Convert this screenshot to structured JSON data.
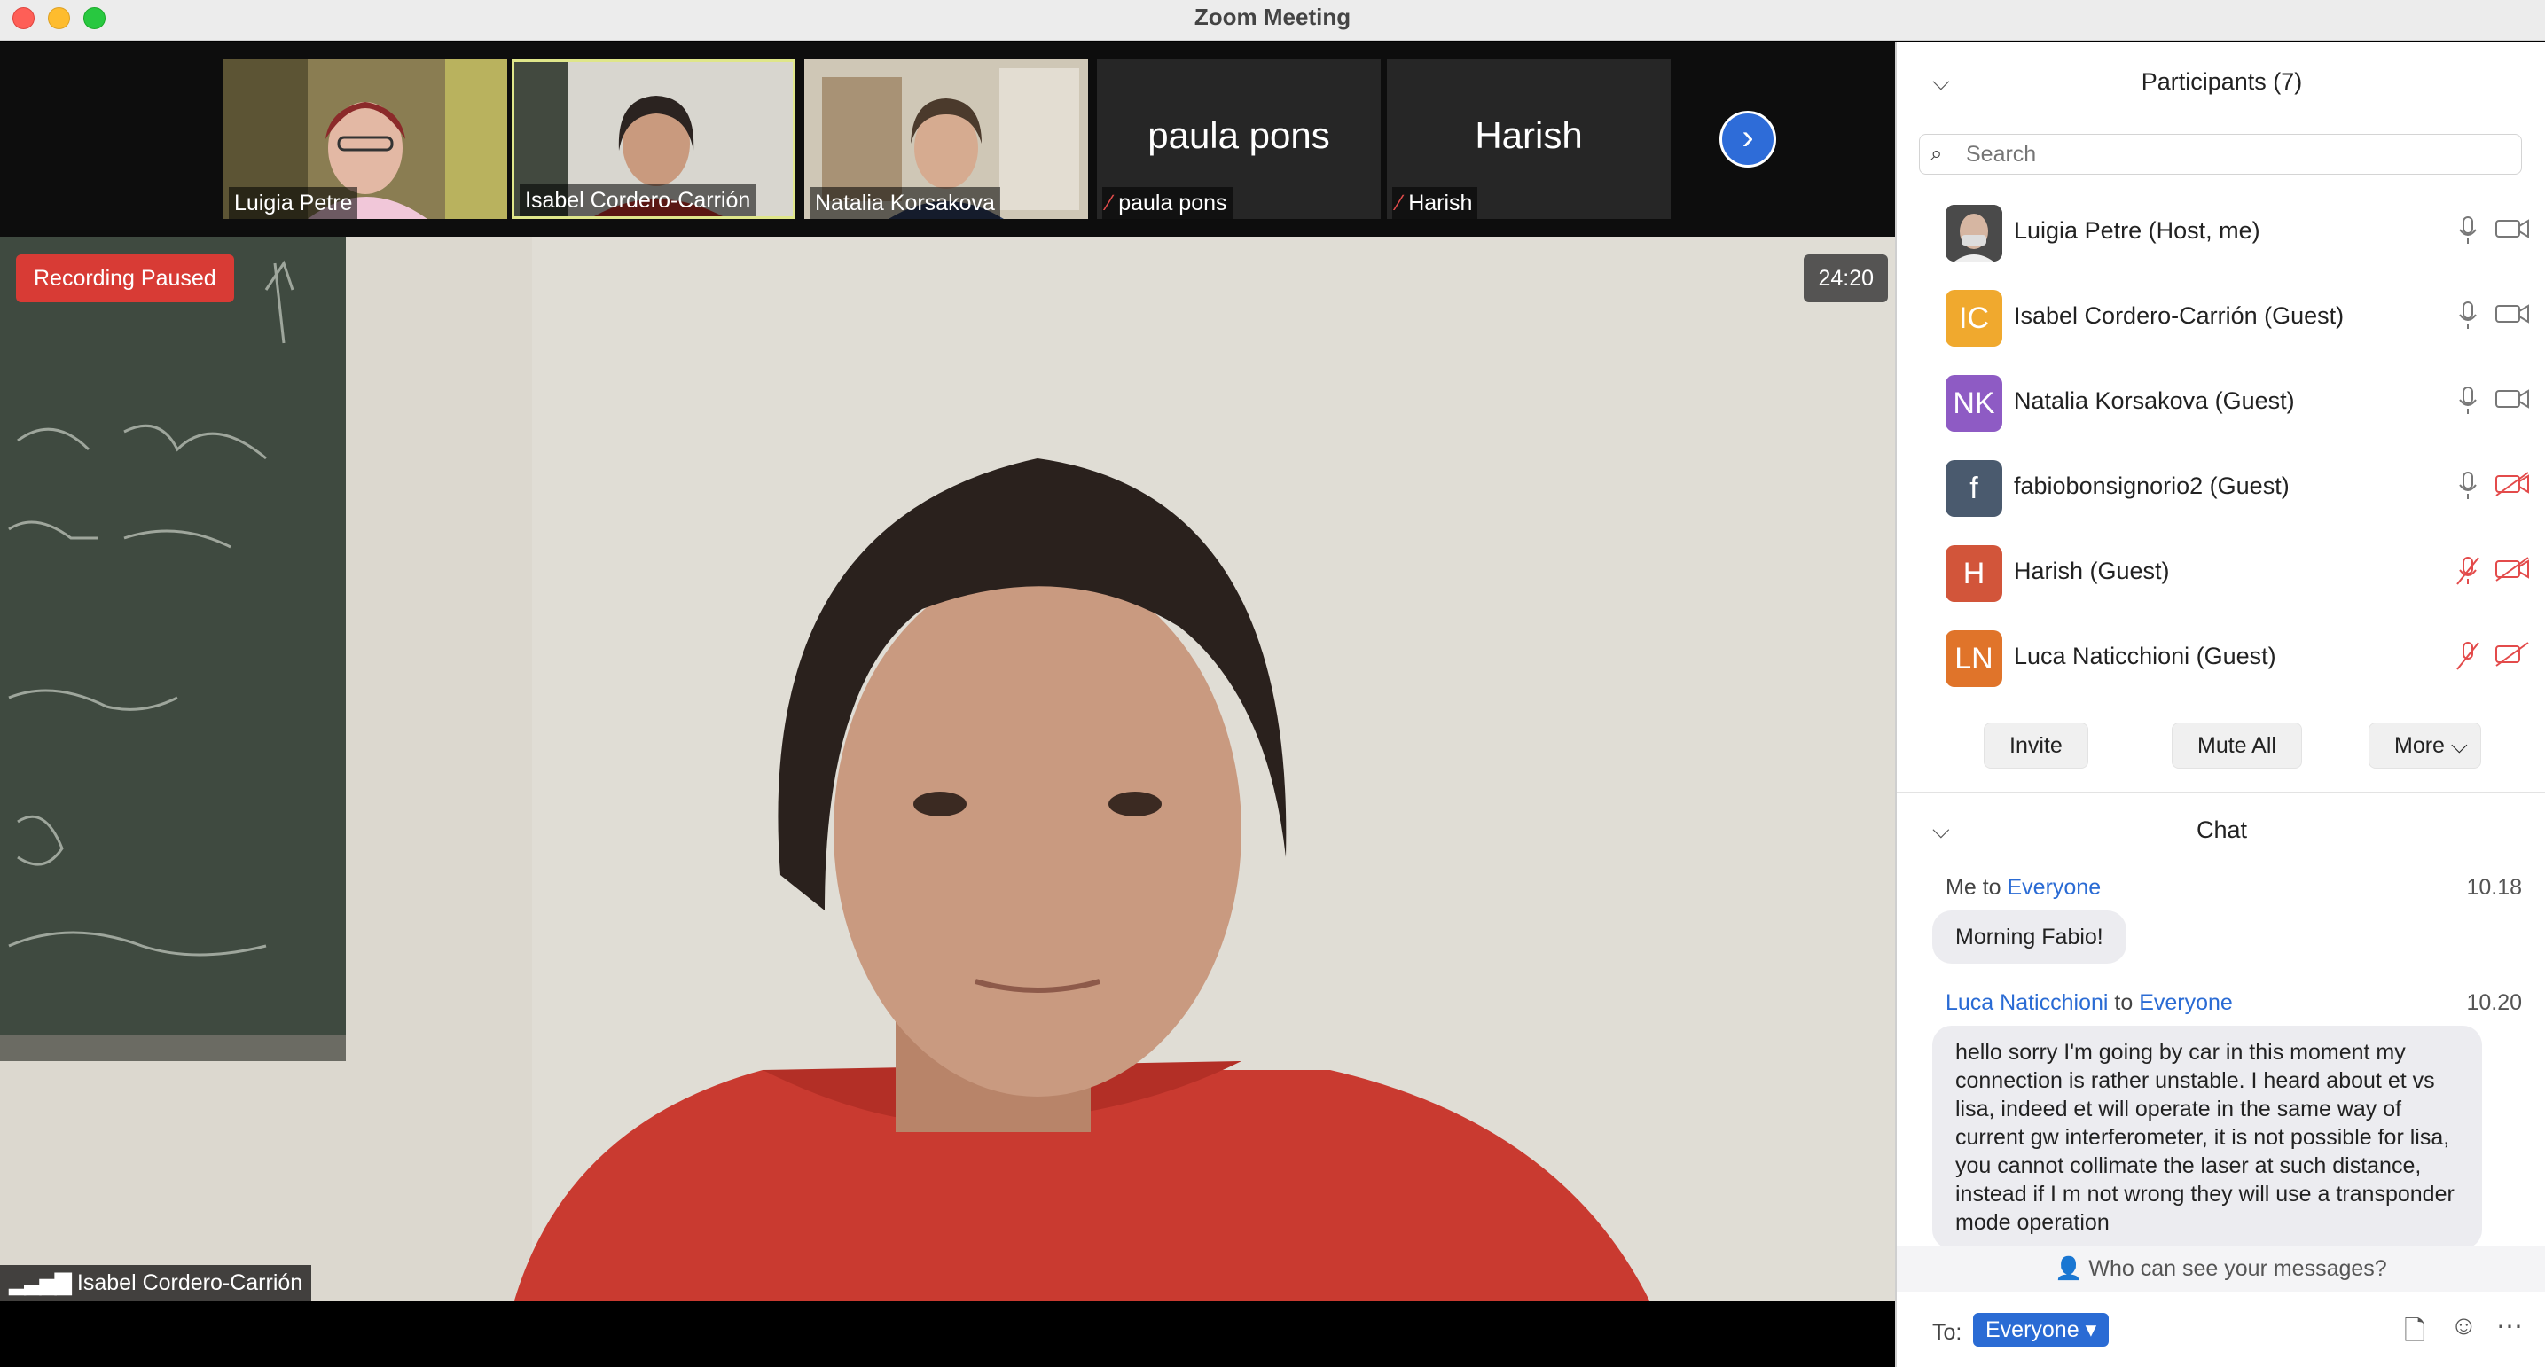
{
  "window": {
    "title": "Zoom Meeting"
  },
  "thumbnails": [
    {
      "name": "Luigia Petre",
      "has_video": true,
      "muted": false
    },
    {
      "name": "Isabel Cordero-Carrión",
      "has_video": true,
      "muted": false,
      "active_speaker": true
    },
    {
      "name": "Natalia Korsakova",
      "has_video": true,
      "muted": false
    },
    {
      "name": "paula pons",
      "big_label": "paula pons",
      "has_video": false,
      "muted": true
    },
    {
      "name": "Harish",
      "big_label": "Harish",
      "has_video": false,
      "muted": true
    }
  ],
  "main_video": {
    "recording_status": "Recording Paused",
    "timer": "24:20",
    "speaker_name": "Isabel Cordero-Carrión"
  },
  "participants": {
    "title": "Participants (7)",
    "search_placeholder": "Search",
    "list": [
      {
        "name": "Luigia Petre (Host, me)",
        "initials": "",
        "color": "#3a3a3a",
        "mic_on": true,
        "cam_on": true
      },
      {
        "name": "Isabel Cordero-Carrión (Guest)",
        "initials": "IC",
        "color": "#f0a92e",
        "mic_on": true,
        "cam_on": true
      },
      {
        "name": "Natalia Korsakova (Guest)",
        "initials": "NK",
        "color": "#8e5bc4",
        "mic_on": true,
        "cam_on": true
      },
      {
        "name": "fabiobonsignorio2 (Guest)",
        "initials": "f",
        "color": "#4a5a6e",
        "mic_on": true,
        "cam_on": false
      },
      {
        "name": "Harish (Guest)",
        "initials": "H",
        "color": "#d2553a",
        "mic_on": false,
        "cam_on": false
      },
      {
        "name": "Luca Naticchioni (Guest)",
        "initials": "LN",
        "color": "#e0742a",
        "mic_on": false,
        "cam_on": false
      }
    ],
    "buttons": {
      "invite": "Invite",
      "mute_all": "Mute All",
      "more": "More"
    }
  },
  "chat": {
    "title": "Chat",
    "messages": [
      {
        "sender": "Me",
        "connector": "to",
        "recipient": "Everyone",
        "time": "10.18",
        "text": "Morning Fabio!"
      },
      {
        "sender": "Luca Naticchioni",
        "connector": "to",
        "recipient": "Everyone",
        "time": "10.20",
        "text": "hello sorry I'm going by car in this moment my connection is rather unstable. I heard about et vs lisa, indeed et will operate in the same way of current gw interferometer, it is not possible for lisa, you cannot collimate the laser at such distance, instead if I m not wrong they will use a transponder mode operation"
      }
    ],
    "who_can_see": "Who can see your messages?",
    "to_label": "To:",
    "to_value": "Everyone"
  },
  "colors": {
    "accent": "#2a6bd4",
    "recording": "#d83b35",
    "muted": "#e34b4b"
  }
}
